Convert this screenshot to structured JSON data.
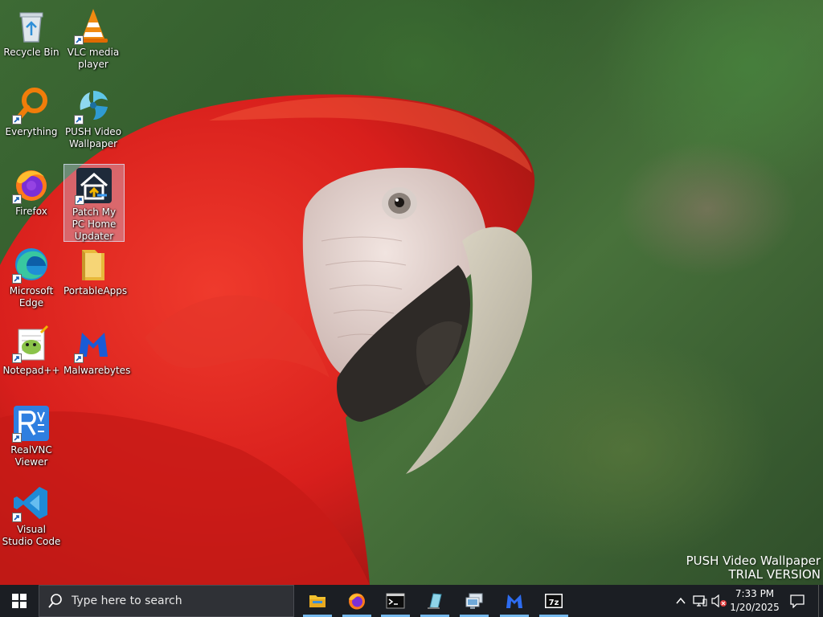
{
  "desktop": {
    "icons": [
      {
        "label": "Recycle Bin",
        "icon": "recycle-bin-icon",
        "shortcut": false
      },
      {
        "label": "VLC media player",
        "icon": "vlc-icon",
        "shortcut": true
      },
      {
        "label": "Everything",
        "icon": "everything-search-icon",
        "shortcut": true
      },
      {
        "label": "PUSH Video Wallpaper",
        "icon": "push-video-wallpaper-icon",
        "shortcut": true
      },
      {
        "label": "Firefox",
        "icon": "firefox-icon",
        "shortcut": true
      },
      {
        "label": "Patch My PC Home Updater",
        "icon": "patch-my-pc-icon",
        "shortcut": true,
        "selected": true
      },
      {
        "label": "Microsoft Edge",
        "icon": "edge-icon",
        "shortcut": true
      },
      {
        "label": "PortableApps",
        "icon": "folder-icon",
        "shortcut": false
      },
      {
        "label": "Notepad++",
        "icon": "notepad-plus-plus-icon",
        "shortcut": true
      },
      {
        "label": "Malwarebytes",
        "icon": "malwarebytes-icon",
        "shortcut": true
      },
      {
        "label": "RealVNC Viewer",
        "icon": "realvnc-icon",
        "shortcut": true
      },
      {
        "label": "Visual Studio Code",
        "icon": "vscode-icon",
        "shortcut": true
      }
    ]
  },
  "watermark": {
    "line1": "PUSH Video Wallpaper",
    "line2": "TRIAL VERSION"
  },
  "taskbar": {
    "start_icon": "windows-logo-icon",
    "search": {
      "placeholder": "Type here to search",
      "value": ""
    },
    "pinned_apps": [
      {
        "name": "File Explorer",
        "icon": "file-explorer-icon",
        "running": true
      },
      {
        "name": "Firefox",
        "icon": "firefox-icon",
        "running": true
      },
      {
        "name": "Command Prompt",
        "icon": "command-prompt-icon",
        "running": true
      },
      {
        "name": "Glass app",
        "icon": "glass-app-icon",
        "running": true
      },
      {
        "name": "Remote desktop",
        "icon": "remote-desktop-icon",
        "running": true
      },
      {
        "name": "Malwarebytes",
        "icon": "malwarebytes-icon",
        "running": true
      },
      {
        "name": "7-Zip",
        "icon": "seven-zip-icon",
        "running": true
      }
    ],
    "tray": {
      "icons": [
        "chevron-up-icon",
        "network-icon",
        "volume-muted-icon"
      ],
      "time": "7:33 PM",
      "date": "1/20/2025"
    },
    "notification_icon": "notification-icon"
  },
  "colors": {
    "taskbar_bg": "#1b1e23",
    "search_bg": "#2f3136",
    "running_indicator": "#76b9ed",
    "parrot_red": "#e0221f"
  }
}
